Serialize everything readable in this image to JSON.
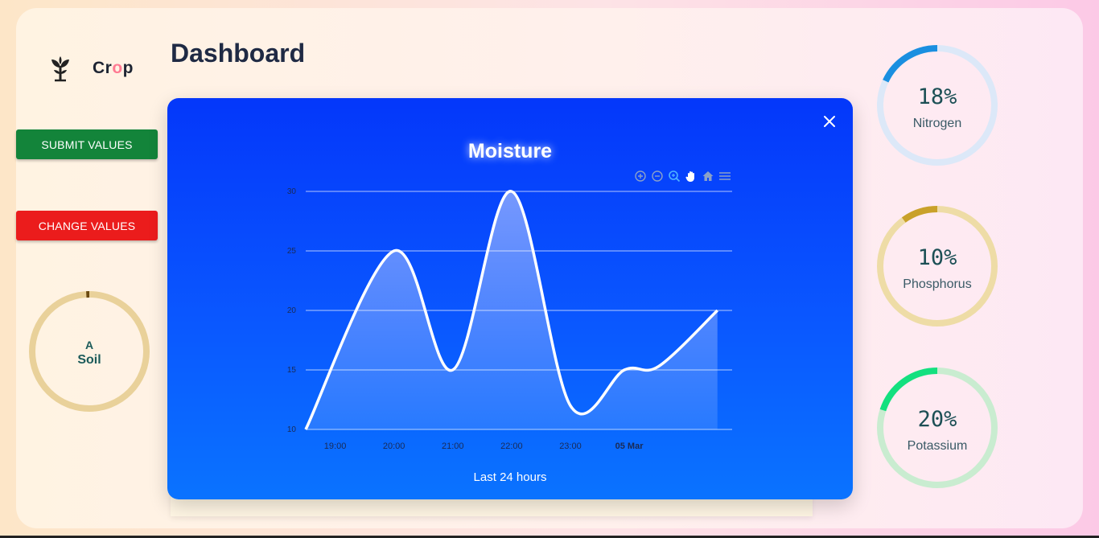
{
  "app": {
    "brand_prefix": "Cr",
    "brand_o": "o",
    "brand_suffix": "p",
    "page_title": "Dashboard"
  },
  "buttons": {
    "submit": "SUBMIT VALUES",
    "change": "CHANGE VALUES"
  },
  "soil": {
    "grade": "A",
    "label": "Soil",
    "color": "#e9d19a",
    "accent": "#6b4a10"
  },
  "nutrients": [
    {
      "label": "Nitrogen",
      "percent_text": "18%",
      "value": 18,
      "track": "#dce8f8",
      "color": "#1a8fe0"
    },
    {
      "label": "Phosphorus",
      "percent_text": "10%",
      "value": 10,
      "track": "#eedca6",
      "color": "#c9a12a"
    },
    {
      "label": "Potassium",
      "percent_text": "20%",
      "value": 20,
      "track": "#c9ecd0",
      "color": "#13e07f"
    }
  ],
  "modal": {
    "title": "Moisture",
    "footer": "Last 24 hours",
    "close_icon": "close-icon"
  },
  "toolbar_icons": [
    "zoom-in-icon",
    "zoom-out-icon",
    "zoom-select-icon",
    "pan-hand-icon",
    "home-icon",
    "menu-icon"
  ],
  "chart_data": {
    "type": "area",
    "title": "Moisture",
    "xlabel": "Last 24 hours",
    "ylabel": "",
    "ylim": [
      10,
      30
    ],
    "yticks": [
      10,
      15,
      20,
      25,
      30
    ],
    "xticks": [
      "19:00",
      "20:00",
      "21:00",
      "22:00",
      "23:00",
      "05 Mar"
    ],
    "x": [
      "18:30",
      "20:00",
      "21:00",
      "22:00",
      "23:00",
      "23:55",
      "00:30",
      "01:30"
    ],
    "series": [
      {
        "values": [
          10,
          25,
          15,
          30,
          12,
          15,
          15.3,
          20
        ]
      }
    ],
    "grid": true,
    "color": "#ffffff"
  }
}
